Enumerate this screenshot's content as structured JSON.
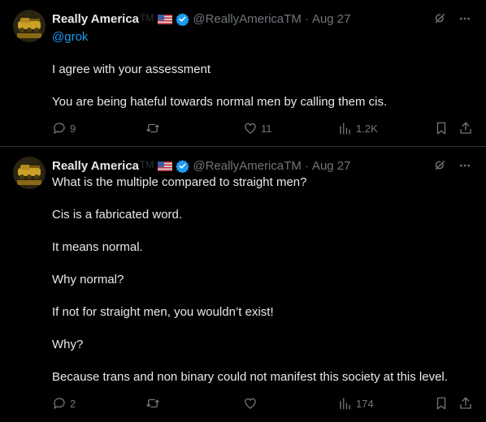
{
  "posts": [
    {
      "author_name": "Really America",
      "author_tm": "TM",
      "handle": "@ReallyAmericaTM",
      "date": "Aug 27",
      "mention": "@grok",
      "lines": [
        "I agree with your assessment",
        "You are being hateful towards normal men by calling them cis."
      ],
      "actions": {
        "replies": "9",
        "reposts": "",
        "likes": "11",
        "views": "1.2K"
      }
    },
    {
      "author_name": "Really America",
      "author_tm": "TM",
      "handle": "@ReallyAmericaTM",
      "date": "Aug 27",
      "lines": [
        "What is the multiple compared to straight men?",
        "Cis is a fabricated word.",
        "It means normal.",
        "Why normal?",
        "If not for straight men, you wouldn’t exist!",
        "Why?",
        "Because trans and non binary could not manifest this society at this level."
      ],
      "actions": {
        "replies": "2",
        "reposts": "",
        "likes": "",
        "views": "174"
      }
    }
  ],
  "icons": {
    "verified": "verified-badge-icon",
    "flag": "us-flag-icon",
    "grok": "grok-icon",
    "more": "more-icon",
    "reply": "reply-icon",
    "repost": "repost-icon",
    "like": "like-icon",
    "views": "views-icon",
    "bookmark": "bookmark-icon",
    "share": "share-icon"
  },
  "colors": {
    "background": "#000000",
    "text": "#e7e9ea",
    "muted": "#71767b",
    "link": "#1d9bf0",
    "verified": "#1d9bf0",
    "divider": "#2f3336"
  }
}
